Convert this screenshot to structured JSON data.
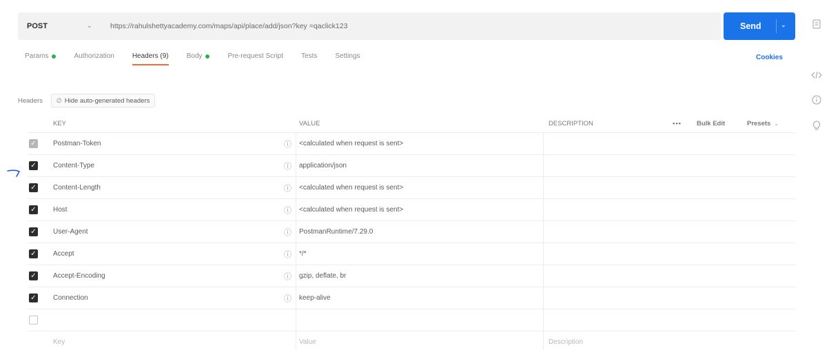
{
  "request": {
    "method": "POST",
    "url": "https://rahulshettyacademy.com/maps/api/place/add/json?key =qaclick123",
    "send_label": "Send"
  },
  "tabs": [
    {
      "label": "Params",
      "dot": true
    },
    {
      "label": "Authorization"
    },
    {
      "label": "Headers (9)",
      "active": true
    },
    {
      "label": "Body",
      "dot": true
    },
    {
      "label": "Pre-request Script"
    },
    {
      "label": "Tests"
    },
    {
      "label": "Settings"
    }
  ],
  "cookies_label": "Cookies",
  "subbar": {
    "label": "Headers",
    "hide_button": "Hide auto-generated headers"
  },
  "table": {
    "columns": {
      "key": "KEY",
      "value": "VALUE",
      "description": "DESCRIPTION"
    },
    "toolbar": {
      "more": "•••",
      "bulk_edit": "Bulk Edit",
      "presets": "Presets"
    },
    "rows": [
      {
        "key": "Postman-Token",
        "value": "<calculated when request is sent>",
        "checked": "gray"
      },
      {
        "key": "Content-Type",
        "value": "application/json",
        "checked": "yes"
      },
      {
        "key": "Content-Length",
        "value": "<calculated when request is sent>",
        "checked": "yes"
      },
      {
        "key": "Host",
        "value": "<calculated when request is sent>",
        "checked": "yes"
      },
      {
        "key": "User-Agent",
        "value": "PostmanRuntime/7.29.0",
        "checked": "yes"
      },
      {
        "key": "Accept",
        "value": "*/*",
        "checked": "yes"
      },
      {
        "key": "Accept-Encoding",
        "value": "gzip, deflate, br",
        "checked": "yes"
      },
      {
        "key": "Connection",
        "value": "keep-alive",
        "checked": "yes"
      }
    ],
    "new_row_placeholders": {
      "key": "Key",
      "value": "Value",
      "description": "Description"
    }
  },
  "icons": {
    "rail": [
      "document-icon",
      "code-icon",
      "info-icon",
      "lightbulb-icon"
    ],
    "info_glyph": "ⓘ"
  },
  "colors": {
    "accent": "#1a73e8",
    "active_tab_underline": "#f26b3a",
    "dot": "#2bb24c",
    "arrow": "#2a5bd7"
  }
}
